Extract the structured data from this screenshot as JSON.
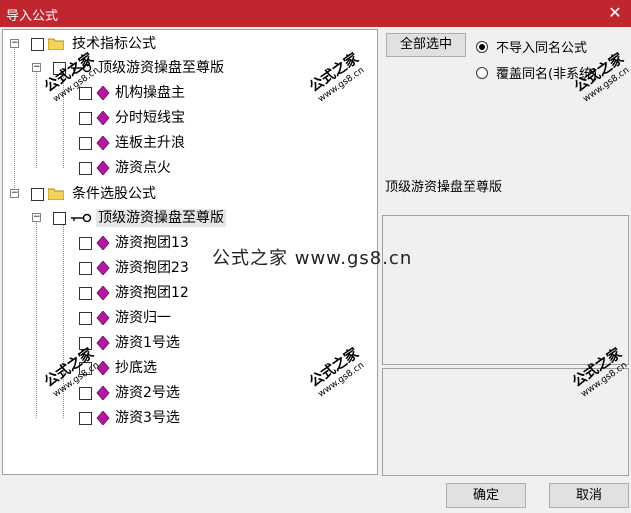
{
  "window": {
    "title": "导入公式",
    "close_symbol": "✕"
  },
  "tree": {
    "groups": [
      {
        "label": "技术指标公式",
        "sub": {
          "label": "顶级游资操盘至尊版",
          "items": [
            "机构操盘主",
            "分时短线宝",
            "连板主升浪",
            "游资点火"
          ]
        }
      },
      {
        "label": "条件选股公式",
        "sub": {
          "label": "顶级游资操盘至尊版",
          "items": [
            "游资抱团13",
            "游资抱团23",
            "游资抱团12",
            "游资归一",
            "游资1号选",
            "抄底选",
            "游资2号选",
            "游资3号选"
          ]
        }
      }
    ]
  },
  "right": {
    "select_all_label": "全部选中",
    "radio_no_import": "不导入同名公式",
    "radio_overwrite": "覆盖同名(非系统)",
    "selected_name": "顶级游资操盘至尊版"
  },
  "footer": {
    "ok_label": "确定",
    "cancel_label": "取消"
  },
  "watermark": {
    "text": "公式之家",
    "url": "www.gs8.cn",
    "center": "公式之家 www.gs8.cn"
  },
  "colors": {
    "titlebar": "#c0262e",
    "gem": "#b5179e"
  },
  "icons": {
    "folder": "folder-icon",
    "key": "key-icon",
    "gem": "gem-icon",
    "close": "close-icon"
  }
}
